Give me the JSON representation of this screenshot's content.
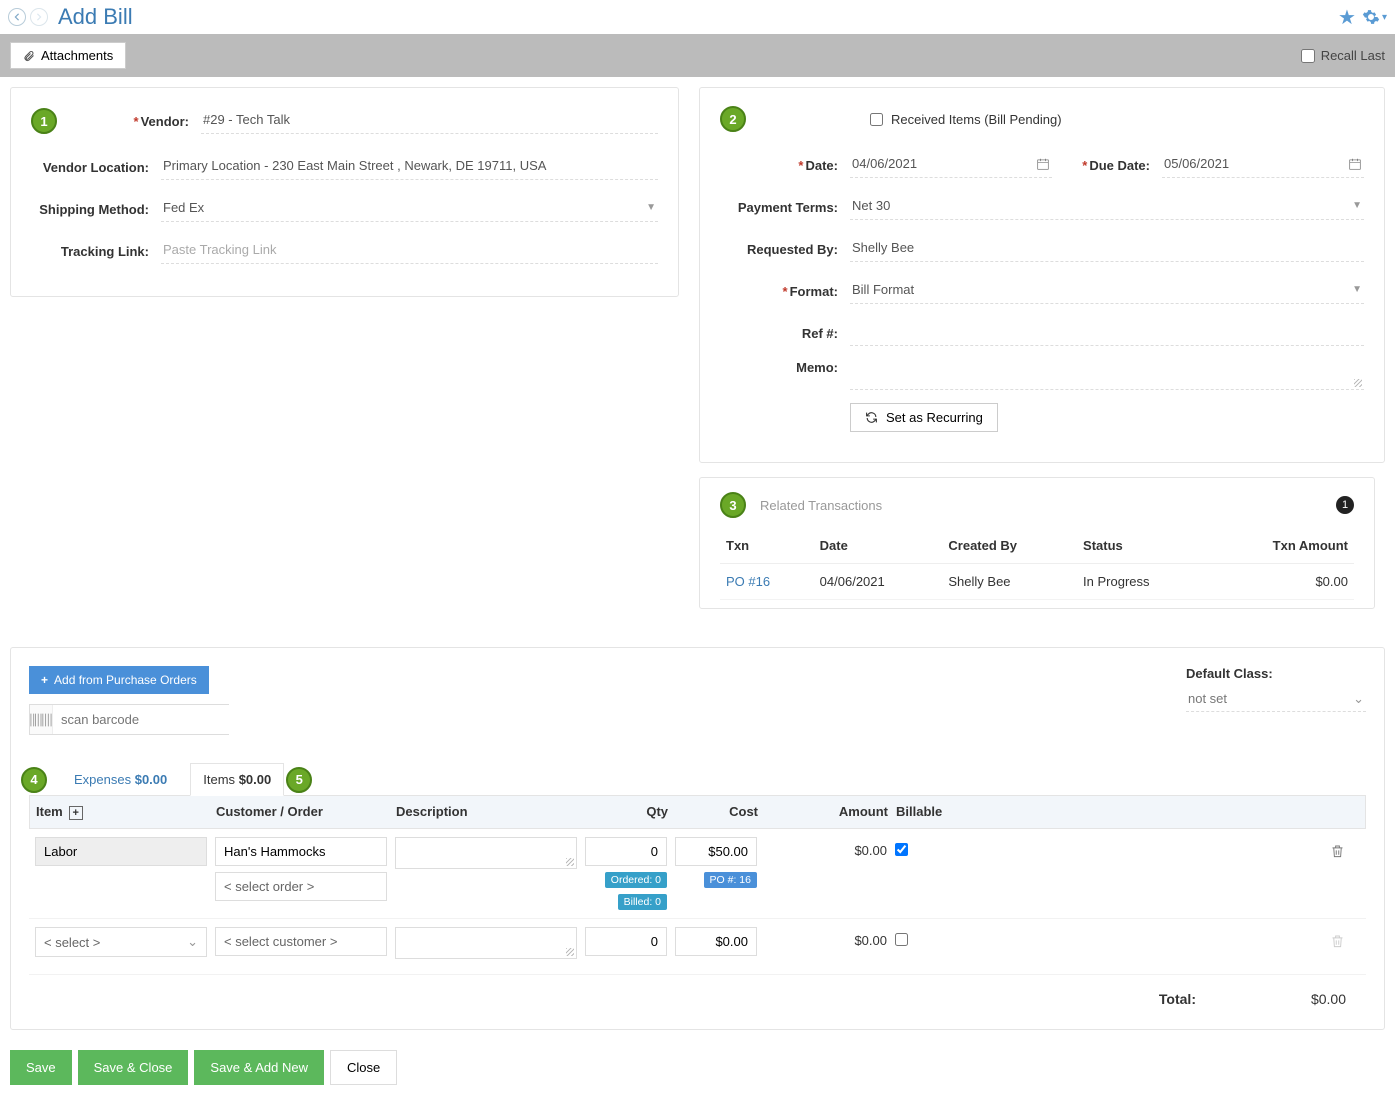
{
  "header": {
    "title": "Add Bill"
  },
  "toolbar": {
    "attachments_label": "Attachments",
    "recall_label": "Recall Last"
  },
  "vendor_section": {
    "vendor_label": "Vendor:",
    "vendor_value": "#29 - Tech Talk",
    "location_label": "Vendor Location:",
    "location_value": "Primary Location -   230 East Main Street , Newark, DE 19711, USA",
    "shipping_label": "Shipping Method:",
    "shipping_value": "Fed Ex",
    "tracking_label": "Tracking Link:",
    "tracking_placeholder": "Paste Tracking Link"
  },
  "bill_section": {
    "received_label": "Received Items (Bill Pending)",
    "date_label": "Date:",
    "date_value": "04/06/2021",
    "due_label": "Due Date:",
    "due_value": "05/06/2021",
    "terms_label": "Payment Terms:",
    "terms_value": "Net 30",
    "requested_label": "Requested By:",
    "requested_value": "Shelly Bee",
    "format_label": "Format:",
    "format_value": "Bill Format",
    "ref_label": "Ref #:",
    "memo_label": "Memo:",
    "recurring_label": "Set as Recurring"
  },
  "related": {
    "title": "Related Transactions",
    "count": "1",
    "cols": {
      "txn": "Txn",
      "date": "Date",
      "by": "Created By",
      "status": "Status",
      "amount": "Txn Amount"
    },
    "rows": [
      {
        "txn": "PO #16",
        "date": "04/06/2021",
        "by": "Shelly Bee",
        "status": "In Progress",
        "amount": "$0.00"
      }
    ]
  },
  "lines": {
    "add_po_label": "Add from Purchase Orders",
    "barcode_placeholder": "scan barcode",
    "default_class_label": "Default Class:",
    "default_class_value": "not set",
    "tab_expenses": "Expenses",
    "tab_expenses_amt": "$0.00",
    "tab_items": "Items",
    "tab_items_amt": "$0.00",
    "cols": {
      "item": "Item",
      "cust": "Customer / Order",
      "desc": "Description",
      "qty": "Qty",
      "cost": "Cost",
      "amount": "Amount",
      "billable": "Billable"
    },
    "row1": {
      "item": "Labor",
      "customer": "Han's Hammocks",
      "order_placeholder": "< select order >",
      "qty": "0",
      "ordered_chip": "Ordered: 0",
      "billed_chip": "Billed: 0",
      "cost": "$50.00",
      "po_chip": "PO #: 16",
      "amount": "$0.00",
      "billable": true
    },
    "row2": {
      "item_placeholder": "< select >",
      "cust_placeholder": "< select customer >",
      "qty": "0",
      "cost": "$0.00",
      "amount": "$0.00",
      "billable": false
    },
    "total_label": "Total:",
    "total_value": "$0.00"
  },
  "footer": {
    "save": "Save",
    "save_close": "Save & Close",
    "save_new": "Save & Add New",
    "close": "Close"
  }
}
